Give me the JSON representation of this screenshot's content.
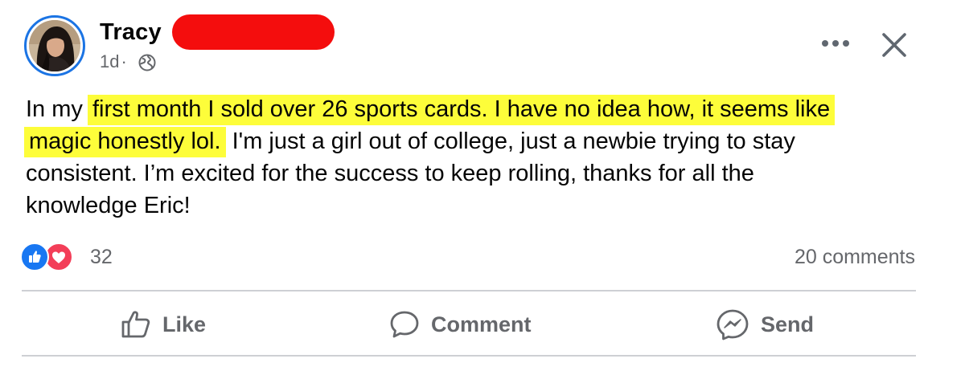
{
  "post": {
    "author": "Tracy",
    "timestamp": "1d",
    "separator": "·",
    "privacy_icon": "globe-icon",
    "text": {
      "line1_pre": "In my ",
      "line1_hl": "first month I sold over 26 sports cards. I have no idea how, it seems like",
      "line2_hl": "magic honestly lol.",
      "line2_post": " I'm just a girl out of college, just a newbie trying to stay",
      "line3": "consistent. I’m excited for the success to keep rolling, thanks for all the",
      "line4": "knowledge Eric!"
    }
  },
  "engagement": {
    "reaction_count": "32",
    "comments_label": "20 comments",
    "reaction_icons": [
      "like-reaction-icon",
      "love-reaction-icon"
    ]
  },
  "actions": {
    "like": "Like",
    "comment": "Comment",
    "send": "Send"
  },
  "colors": {
    "highlight": "#fdfd3a",
    "redaction": "#f40d0d",
    "brand_blue": "#1877f2",
    "love_red": "#f33e58",
    "secondary_text": "#65676b"
  }
}
